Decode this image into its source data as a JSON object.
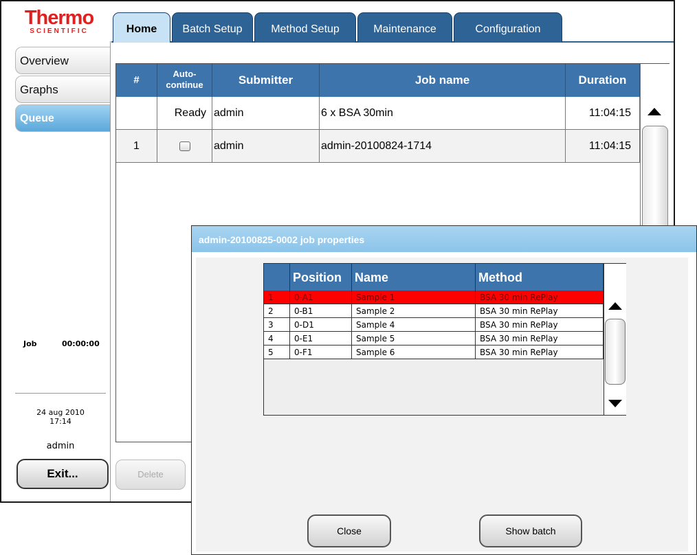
{
  "logo": {
    "main": "Thermo",
    "sub": "SCIENTIFIC"
  },
  "tabs": [
    {
      "label": "Home",
      "active": true
    },
    {
      "label": "Batch Setup",
      "active": false
    },
    {
      "label": "Method Setup",
      "active": false
    },
    {
      "label": "Maintenance",
      "active": false
    },
    {
      "label": "Configuration",
      "active": false
    }
  ],
  "sidebar": {
    "items": [
      {
        "label": "Overview",
        "active": false
      },
      {
        "label": "Graphs",
        "active": false
      },
      {
        "label": "Queue",
        "active": true
      }
    ],
    "job_label": "Job",
    "job_time": "00:00:00",
    "date": "24 aug 2010",
    "time": "17:14",
    "user": "admin",
    "exit_label": "Exit..."
  },
  "queue": {
    "headers": {
      "num": "#",
      "auto": "Auto-\ncontinue",
      "submitter": "Submitter",
      "job": "Job name",
      "duration": "Duration"
    },
    "rows": [
      {
        "num": "",
        "auto": "Ready",
        "auto_checkbox": false,
        "submitter": "admin",
        "job": "6 x BSA 30min",
        "duration": "11:04:15"
      },
      {
        "num": "1",
        "auto": "",
        "auto_checkbox": true,
        "submitter": "admin",
        "job": "admin-20100824-1714",
        "duration": "11:04:15"
      }
    ],
    "delete_label": "Delete"
  },
  "dialog": {
    "title": "admin-20100825-0002 job properties",
    "headers": {
      "num": "",
      "position": "Position",
      "name": "Name",
      "method": "Method"
    },
    "rows": [
      {
        "num": "1",
        "position": "0-A1",
        "name": "Sample 1",
        "method": "BSA 30 min RePlay",
        "selected": true
      },
      {
        "num": "2",
        "position": "0-B1",
        "name": "Sample 2",
        "method": "BSA 30 min RePlay",
        "selected": false
      },
      {
        "num": "3",
        "position": "0-D1",
        "name": "Sample 4",
        "method": "BSA 30 min RePlay",
        "selected": false
      },
      {
        "num": "4",
        "position": "0-E1",
        "name": "Sample 5",
        "method": "BSA 30 min RePlay",
        "selected": false
      },
      {
        "num": "5",
        "position": "0-F1",
        "name": "Sample 6",
        "method": "BSA 30 min RePlay",
        "selected": false
      }
    ],
    "close_label": "Close",
    "show_batch_label": "Show batch"
  },
  "colors": {
    "accent": "#3d74ab",
    "tab_active": "#c6e2f4",
    "selected_row": "#ff0000",
    "logo_red": "#e02020"
  }
}
